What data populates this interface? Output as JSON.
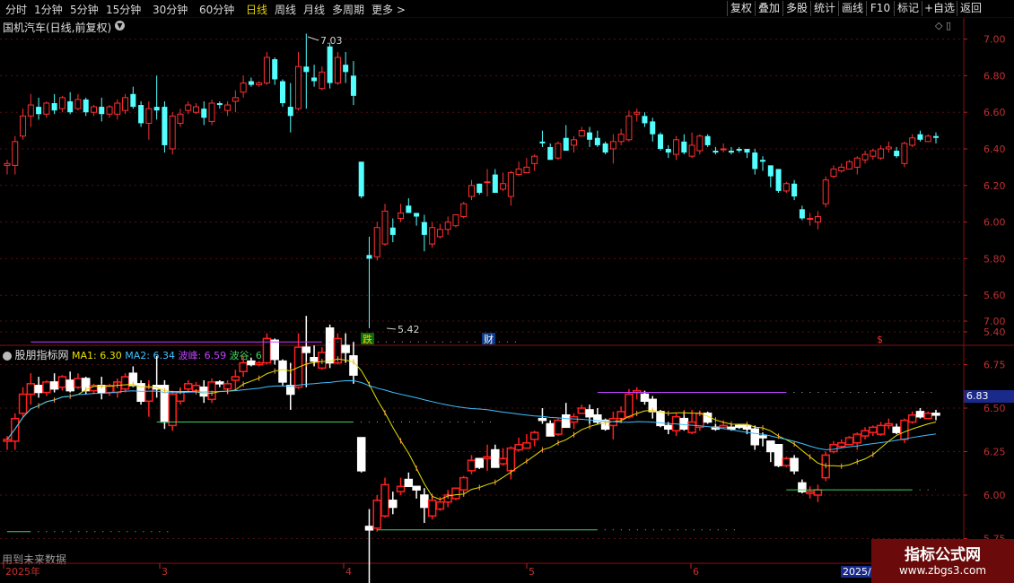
{
  "toolbar": {
    "periods": [
      "分时",
      "1分钟",
      "5分钟",
      "15分钟",
      "30分钟",
      "60分钟",
      "日线",
      "周线",
      "月线",
      "多周期",
      "更多 >"
    ],
    "active": "日线",
    "right": [
      "复权",
      "叠加",
      "多股",
      "统计",
      "画线",
      "F10",
      "标记",
      "+自选",
      "返回"
    ]
  },
  "main_panel": {
    "title": "国机汽车(日线,前复权)",
    "y_ticks": [
      "7.00",
      "6.80",
      "6.60",
      "6.40",
      "6.20",
      "6.00",
      "5.80",
      "5.60",
      "5.40"
    ],
    "high_label": "7.03",
    "low_label": "5.42",
    "markers": [
      "跌",
      "财",
      "$"
    ]
  },
  "indicator_panel": {
    "name": "股朋指标网",
    "ma1_label": "MA1: 6.30",
    "ma2_label": "MA2: 6.34",
    "peak_label": "波峰: 6.59",
    "trough_label": "波谷: 6.03",
    "y_ticks": [
      "7.00",
      "6.75",
      "6.50",
      "6.25",
      "6.00",
      "5.75"
    ],
    "hover_price": "6.83",
    "future_note": "用到未来数据"
  },
  "time_axis": {
    "labels": [
      "2025年",
      "3",
      "4",
      "5",
      "6"
    ],
    "cursor_date": "2025/"
  },
  "watermark": {
    "line1": "指标公式网",
    "line2": "www.zbgs3.com"
  },
  "colors": {
    "up": "#ff3030",
    "down": "#54ffff",
    "ma1": "#e8e000",
    "ma2": "#40c0ff",
    "peak": "#c040ff",
    "trough": "#40d060"
  },
  "chart_data": {
    "type": "candlestick",
    "ylim": [
      5.4,
      7.0
    ],
    "candles": [
      {
        "o": 6.31,
        "h": 6.34,
        "l": 6.26,
        "c": 6.32
      },
      {
        "o": 6.31,
        "h": 6.47,
        "l": 6.26,
        "c": 6.44
      },
      {
        "o": 6.47,
        "h": 6.62,
        "l": 6.45,
        "c": 6.58
      },
      {
        "o": 6.58,
        "h": 6.7,
        "l": 6.52,
        "c": 6.64
      },
      {
        "o": 6.63,
        "h": 6.68,
        "l": 6.56,
        "c": 6.59
      },
      {
        "o": 6.59,
        "h": 6.66,
        "l": 6.57,
        "c": 6.65
      },
      {
        "o": 6.65,
        "h": 6.7,
        "l": 6.59,
        "c": 6.61
      },
      {
        "o": 6.62,
        "h": 6.69,
        "l": 6.6,
        "c": 6.68
      },
      {
        "o": 6.66,
        "h": 6.71,
        "l": 6.59,
        "c": 6.6
      },
      {
        "o": 6.62,
        "h": 6.7,
        "l": 6.61,
        "c": 6.67
      },
      {
        "o": 6.67,
        "h": 6.68,
        "l": 6.58,
        "c": 6.6
      },
      {
        "o": 6.6,
        "h": 6.64,
        "l": 6.58,
        "c": 6.63
      },
      {
        "o": 6.63,
        "h": 6.68,
        "l": 6.55,
        "c": 6.59
      },
      {
        "o": 6.59,
        "h": 6.64,
        "l": 6.57,
        "c": 6.63
      },
      {
        "o": 6.59,
        "h": 6.67,
        "l": 6.56,
        "c": 6.65
      },
      {
        "o": 6.61,
        "h": 6.7,
        "l": 6.59,
        "c": 6.68
      },
      {
        "o": 6.7,
        "h": 6.74,
        "l": 6.62,
        "c": 6.63
      },
      {
        "o": 6.64,
        "h": 6.66,
        "l": 6.52,
        "c": 6.54
      },
      {
        "o": 6.54,
        "h": 6.66,
        "l": 6.45,
        "c": 6.62
      },
      {
        "o": 6.63,
        "h": 6.8,
        "l": 6.56,
        "c": 6.61
      },
      {
        "o": 6.63,
        "h": 6.66,
        "l": 6.38,
        "c": 6.42
      },
      {
        "o": 6.4,
        "h": 6.6,
        "l": 6.37,
        "c": 6.58
      },
      {
        "o": 6.54,
        "h": 6.62,
        "l": 6.52,
        "c": 6.59
      },
      {
        "o": 6.61,
        "h": 6.66,
        "l": 6.59,
        "c": 6.64
      },
      {
        "o": 6.6,
        "h": 6.65,
        "l": 6.59,
        "c": 6.63
      },
      {
        "o": 6.62,
        "h": 6.66,
        "l": 6.53,
        "c": 6.57
      },
      {
        "o": 6.55,
        "h": 6.67,
        "l": 6.53,
        "c": 6.65
      },
      {
        "o": 6.65,
        "h": 6.66,
        "l": 6.62,
        "c": 6.64
      },
      {
        "o": 6.61,
        "h": 6.66,
        "l": 6.58,
        "c": 6.64
      },
      {
        "o": 6.66,
        "h": 6.72,
        "l": 6.6,
        "c": 6.68
      },
      {
        "o": 6.71,
        "h": 6.8,
        "l": 6.68,
        "c": 6.76
      },
      {
        "o": 6.77,
        "h": 6.79,
        "l": 6.74,
        "c": 6.75
      },
      {
        "o": 6.75,
        "h": 6.77,
        "l": 6.74,
        "c": 6.76
      },
      {
        "o": 6.76,
        "h": 6.93,
        "l": 6.75,
        "c": 6.9
      },
      {
        "o": 6.89,
        "h": 6.9,
        "l": 6.75,
        "c": 6.78
      },
      {
        "o": 6.77,
        "h": 6.78,
        "l": 6.63,
        "c": 6.65
      },
      {
        "o": 6.63,
        "h": 6.76,
        "l": 6.49,
        "c": 6.58
      },
      {
        "o": 6.62,
        "h": 6.93,
        "l": 6.61,
        "c": 6.85
      },
      {
        "o": 6.85,
        "h": 7.03,
        "l": 6.62,
        "c": 6.82
      },
      {
        "o": 6.79,
        "h": 6.86,
        "l": 6.74,
        "c": 6.77
      },
      {
        "o": 6.73,
        "h": 6.85,
        "l": 6.72,
        "c": 6.82
      },
      {
        "o": 6.96,
        "h": 6.98,
        "l": 6.73,
        "c": 6.76
      },
      {
        "o": 6.76,
        "h": 6.93,
        "l": 6.75,
        "c": 6.9
      },
      {
        "o": 6.86,
        "h": 6.93,
        "l": 6.76,
        "c": 6.82
      },
      {
        "o": 6.8,
        "h": 6.88,
        "l": 6.64,
        "c": 6.69
      },
      {
        "o": 6.33,
        "h": 6.33,
        "l": 6.13,
        "c": 6.14
      },
      {
        "o": 5.82,
        "h": 5.92,
        "l": 5.42,
        "c": 5.8
      },
      {
        "o": 5.81,
        "h": 6.0,
        "l": 5.79,
        "c": 5.97
      },
      {
        "o": 5.88,
        "h": 6.1,
        "l": 5.87,
        "c": 6.06
      },
      {
        "o": 5.97,
        "h": 6.02,
        "l": 5.89,
        "c": 5.93
      },
      {
        "o": 6.02,
        "h": 6.1,
        "l": 6.0,
        "c": 6.05
      },
      {
        "o": 6.09,
        "h": 6.13,
        "l": 6.05,
        "c": 6.05
      },
      {
        "o": 6.05,
        "h": 6.05,
        "l": 5.98,
        "c": 6.03
      },
      {
        "o": 6.0,
        "h": 6.04,
        "l": 5.84,
        "c": 5.93
      },
      {
        "o": 5.88,
        "h": 6.0,
        "l": 5.86,
        "c": 5.97
      },
      {
        "o": 5.92,
        "h": 5.99,
        "l": 5.91,
        "c": 5.96
      },
      {
        "o": 5.96,
        "h": 6.03,
        "l": 5.93,
        "c": 6.0
      },
      {
        "o": 5.98,
        "h": 6.04,
        "l": 5.97,
        "c": 6.04
      },
      {
        "o": 6.03,
        "h": 6.11,
        "l": 6.02,
        "c": 6.1
      },
      {
        "o": 6.14,
        "h": 6.23,
        "l": 6.12,
        "c": 6.2
      },
      {
        "o": 6.21,
        "h": 6.21,
        "l": 6.15,
        "c": 6.16
      },
      {
        "o": 6.22,
        "h": 6.29,
        "l": 6.14,
        "c": 6.22
      },
      {
        "o": 6.26,
        "h": 6.29,
        "l": 6.16,
        "c": 6.16
      },
      {
        "o": 6.18,
        "h": 6.27,
        "l": 6.17,
        "c": 6.21
      },
      {
        "o": 6.14,
        "h": 6.28,
        "l": 6.09,
        "c": 6.27
      },
      {
        "o": 6.26,
        "h": 6.33,
        "l": 6.25,
        "c": 6.29
      },
      {
        "o": 6.27,
        "h": 6.35,
        "l": 6.27,
        "c": 6.3
      },
      {
        "o": 6.32,
        "h": 6.37,
        "l": 6.28,
        "c": 6.36
      },
      {
        "o": 6.44,
        "h": 6.5,
        "l": 6.41,
        "c": 6.43
      },
      {
        "o": 6.41,
        "h": 6.43,
        "l": 6.34,
        "c": 6.34
      },
      {
        "o": 6.35,
        "h": 6.44,
        "l": 6.34,
        "c": 6.43
      },
      {
        "o": 6.46,
        "h": 6.53,
        "l": 6.39,
        "c": 6.39
      },
      {
        "o": 6.42,
        "h": 6.47,
        "l": 6.38,
        "c": 6.45
      },
      {
        "o": 6.47,
        "h": 6.52,
        "l": 6.47,
        "c": 6.5
      },
      {
        "o": 6.49,
        "h": 6.52,
        "l": 6.41,
        "c": 6.45
      },
      {
        "o": 6.46,
        "h": 6.5,
        "l": 6.41,
        "c": 6.42
      },
      {
        "o": 6.43,
        "h": 6.44,
        "l": 6.37,
        "c": 6.38
      },
      {
        "o": 6.4,
        "h": 6.48,
        "l": 6.32,
        "c": 6.44
      },
      {
        "o": 6.44,
        "h": 6.51,
        "l": 6.42,
        "c": 6.48
      },
      {
        "o": 6.45,
        "h": 6.61,
        "l": 6.44,
        "c": 6.58
      },
      {
        "o": 6.59,
        "h": 6.62,
        "l": 6.55,
        "c": 6.6
      },
      {
        "o": 6.58,
        "h": 6.6,
        "l": 6.52,
        "c": 6.54
      },
      {
        "o": 6.55,
        "h": 6.57,
        "l": 6.44,
        "c": 6.48
      },
      {
        "o": 6.48,
        "h": 6.49,
        "l": 6.39,
        "c": 6.4
      },
      {
        "o": 6.4,
        "h": 6.42,
        "l": 6.35,
        "c": 6.38
      },
      {
        "o": 6.37,
        "h": 6.47,
        "l": 6.34,
        "c": 6.45
      },
      {
        "o": 6.44,
        "h": 6.48,
        "l": 6.37,
        "c": 6.38
      },
      {
        "o": 6.36,
        "h": 6.49,
        "l": 6.35,
        "c": 6.42
      },
      {
        "o": 6.39,
        "h": 6.48,
        "l": 6.37,
        "c": 6.47
      },
      {
        "o": 6.47,
        "h": 6.48,
        "l": 6.41,
        "c": 6.42
      },
      {
        "o": 6.39,
        "h": 6.41,
        "l": 6.37,
        "c": 6.38
      },
      {
        "o": 6.4,
        "h": 6.43,
        "l": 6.38,
        "c": 6.4
      },
      {
        "o": 6.39,
        "h": 6.41,
        "l": 6.37,
        "c": 6.38
      },
      {
        "o": 6.4,
        "h": 6.41,
        "l": 6.38,
        "c": 6.39
      },
      {
        "o": 6.4,
        "h": 6.4,
        "l": 6.35,
        "c": 6.38
      },
      {
        "o": 6.38,
        "h": 6.4,
        "l": 6.26,
        "c": 6.29
      },
      {
        "o": 6.34,
        "h": 6.36,
        "l": 6.28,
        "c": 6.33
      },
      {
        "o": 6.31,
        "h": 6.31,
        "l": 6.19,
        "c": 6.25
      },
      {
        "o": 6.29,
        "h": 6.29,
        "l": 6.16,
        "c": 6.17
      },
      {
        "o": 6.17,
        "h": 6.22,
        "l": 6.16,
        "c": 6.21
      },
      {
        "o": 6.21,
        "h": 6.23,
        "l": 6.12,
        "c": 6.14
      },
      {
        "o": 6.07,
        "h": 6.09,
        "l": 6.01,
        "c": 6.02
      },
      {
        "o": 6.02,
        "h": 6.05,
        "l": 5.98,
        "c": 6.02
      },
      {
        "o": 6.0,
        "h": 6.06,
        "l": 5.96,
        "c": 6.03
      },
      {
        "o": 6.1,
        "h": 6.25,
        "l": 6.08,
        "c": 6.23
      },
      {
        "o": 6.25,
        "h": 6.31,
        "l": 6.24,
        "c": 6.29
      },
      {
        "o": 6.28,
        "h": 6.32,
        "l": 6.27,
        "c": 6.3
      },
      {
        "o": 6.29,
        "h": 6.34,
        "l": 6.29,
        "c": 6.33
      },
      {
        "o": 6.3,
        "h": 6.36,
        "l": 6.26,
        "c": 6.35
      },
      {
        "o": 6.34,
        "h": 6.39,
        "l": 6.32,
        "c": 6.37
      },
      {
        "o": 6.36,
        "h": 6.4,
        "l": 6.34,
        "c": 6.39
      },
      {
        "o": 6.35,
        "h": 6.42,
        "l": 6.34,
        "c": 6.4
      },
      {
        "o": 6.4,
        "h": 6.44,
        "l": 6.38,
        "c": 6.41
      },
      {
        "o": 6.39,
        "h": 6.41,
        "l": 6.35,
        "c": 6.36
      },
      {
        "o": 6.32,
        "h": 6.44,
        "l": 6.3,
        "c": 6.43
      },
      {
        "o": 6.42,
        "h": 6.48,
        "l": 6.41,
        "c": 6.46
      },
      {
        "o": 6.48,
        "h": 6.5,
        "l": 6.44,
        "c": 6.45
      },
      {
        "o": 6.44,
        "h": 6.48,
        "l": 6.44,
        "c": 6.47
      },
      {
        "o": 6.47,
        "h": 6.49,
        "l": 6.43,
        "c": 6.46
      }
    ],
    "peak_lines": [
      {
        "value": 6.88,
        "from": 3,
        "to": 40
      },
      {
        "value": 6.59,
        "from": 75,
        "to": 99
      }
    ],
    "trough_lines": [
      {
        "value": 6.42,
        "from": 19,
        "to": 44
      },
      {
        "value": 5.79,
        "from": 0,
        "to": 3
      },
      {
        "value": 5.8,
        "from": 47,
        "to": 75
      },
      {
        "value": 6.03,
        "from": 99,
        "to": 115
      }
    ]
  }
}
